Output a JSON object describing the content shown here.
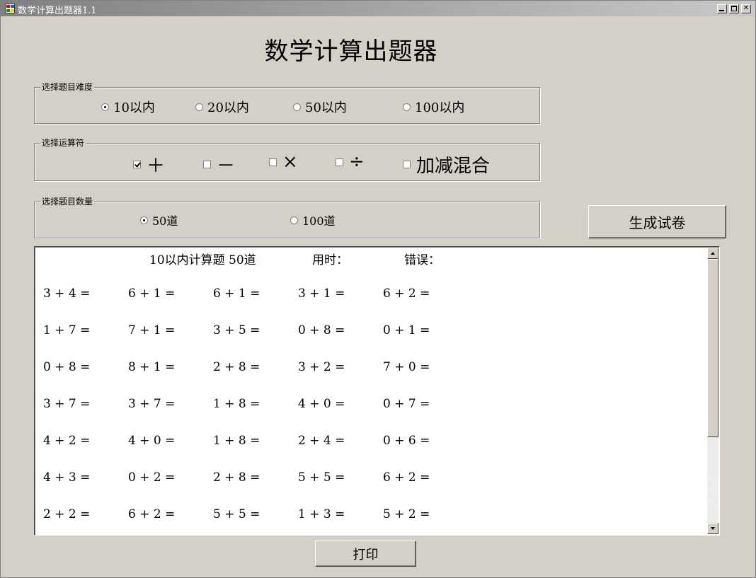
{
  "window": {
    "title": "数学计算出题器1.1"
  },
  "app_title": "数学计算出题器",
  "difficulty": {
    "legend": "选择题目难度",
    "options": [
      {
        "label": "10以内",
        "selected": true
      },
      {
        "label": "20以内",
        "selected": false
      },
      {
        "label": "50以内",
        "selected": false
      },
      {
        "label": "100以内",
        "selected": false
      }
    ]
  },
  "operators": {
    "legend": "选择运算符",
    "options": [
      {
        "label": "＋",
        "checked": true
      },
      {
        "label": "－",
        "checked": false
      },
      {
        "label": "×",
        "checked": false
      },
      {
        "label": "÷",
        "checked": false
      },
      {
        "label": "加减混合",
        "checked": false
      }
    ]
  },
  "quantity": {
    "legend": "选择题目数量",
    "options": [
      {
        "label": "50道",
        "selected": true
      },
      {
        "label": "100道",
        "selected": false
      }
    ]
  },
  "buttons": {
    "generate": "生成试卷",
    "print": "打印"
  },
  "paper": {
    "heading": "10以内计算题 50道",
    "time_label": "用时：",
    "error_label": "错误：",
    "rows": [
      [
        "3 + 4 =",
        "6 + 1 =",
        "6 + 1 =",
        "3 + 1 =",
        "6 + 2 ="
      ],
      [
        "1 + 7 =",
        "7 + 1 =",
        "3 + 5 =",
        "0 + 8 =",
        "0 + 1 ="
      ],
      [
        "0 + 8 =",
        "8 + 1 =",
        "2 + 8 =",
        "3 + 2 =",
        "7 + 0 ="
      ],
      [
        "3 + 7 =",
        "3 + 7 =",
        "1 + 8 =",
        "4 + 0 =",
        "0 + 7 ="
      ],
      [
        "4 + 2 =",
        "4 + 0 =",
        "1 + 8 =",
        "2 + 4 =",
        "0 + 6 ="
      ],
      [
        "4 + 3 =",
        "0 + 2 =",
        "2 + 8 =",
        "5 + 5 =",
        "6 + 2 ="
      ],
      [
        "2 + 2 =",
        "6 + 2 =",
        "5 + 5 =",
        "1 + 3 =",
        "5 + 2 ="
      ]
    ]
  }
}
